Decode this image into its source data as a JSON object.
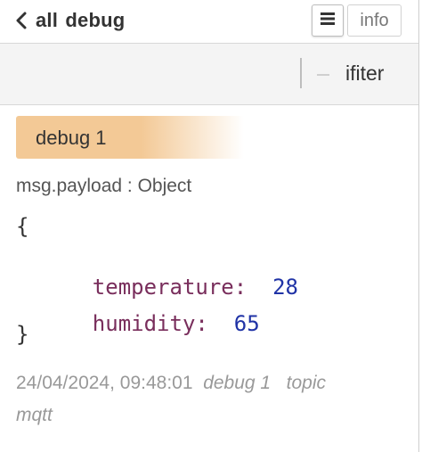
{
  "header": {
    "title": "all  debug",
    "info_label": "info"
  },
  "toolbar": {
    "filter_label": "ifiter"
  },
  "message": {
    "source_badge": "debug 1",
    "type_line": "msg.payload : Object",
    "open_brace": "{",
    "close_brace": "}",
    "fields": [
      {
        "key": "temperature:",
        "value": "28"
      },
      {
        "key": "humidity:",
        "value": "65"
      }
    ],
    "timestamp": "24/04/2024, 09:48:01",
    "node_name": "debug 1",
    "topic_label": "topic",
    "topic_value": "mqtt"
  },
  "colors": {
    "badge": "#f3c996",
    "key": "#792e5c",
    "number": "#2033a6"
  },
  "icons": {
    "back": "chevron-left-icon",
    "menu": "hamburger-menu-icon"
  }
}
